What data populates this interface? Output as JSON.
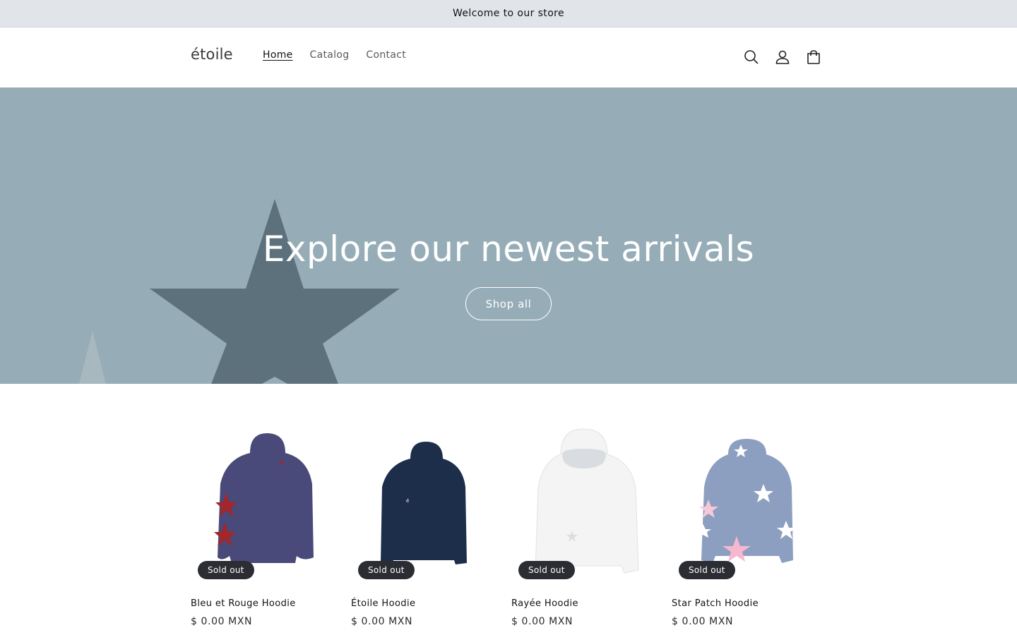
{
  "announcement": {
    "text": "Welcome to our store"
  },
  "header": {
    "logo": "étoile",
    "nav": [
      {
        "label": "Home",
        "active": true
      },
      {
        "label": "Catalog",
        "active": false
      },
      {
        "label": "Contact",
        "active": false
      }
    ],
    "icons": [
      "search-icon",
      "account-icon",
      "cart-icon"
    ]
  },
  "hero": {
    "title": "Explore our newest arrivals",
    "button_label": "Shop all",
    "background_color": "#96adb7"
  },
  "products": [
    {
      "name": "Bleu et Rouge Hoodie",
      "price": "$ 0.00 MXN",
      "badge": "Sold out",
      "color": "#4a4a7a"
    },
    {
      "name": "Étoile Hoodie",
      "price": "$ 0.00 MXN",
      "badge": "Sold out",
      "color": "#1c2e4a"
    },
    {
      "name": "Rayée Hoodie",
      "price": "$ 0.00 MXN",
      "badge": "Sold out",
      "color": "#f4f4f4"
    },
    {
      "name": "Star Patch Hoodie",
      "price": "$ 0.00 MXN",
      "badge": "Sold out",
      "color": "#8d9fc0"
    }
  ]
}
